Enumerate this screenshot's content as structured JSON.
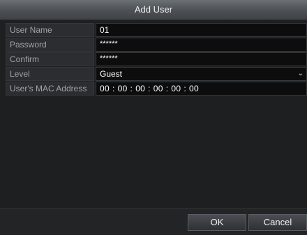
{
  "dialog": {
    "title": "Add User"
  },
  "form": {
    "user_name": {
      "label": "User Name",
      "value": "01"
    },
    "password": {
      "label": "Password",
      "value": "******"
    },
    "confirm": {
      "label": "Confirm",
      "value": "******"
    },
    "level": {
      "label": "Level",
      "value": "Guest",
      "icon": "chevron-down-icon"
    },
    "mac": {
      "label": "User's MAC Address",
      "segments": [
        "00",
        "00",
        "00",
        "00",
        "00",
        "00"
      ],
      "separator": ":"
    }
  },
  "footer": {
    "ok_label": "OK",
    "cancel_label": "Cancel"
  }
}
